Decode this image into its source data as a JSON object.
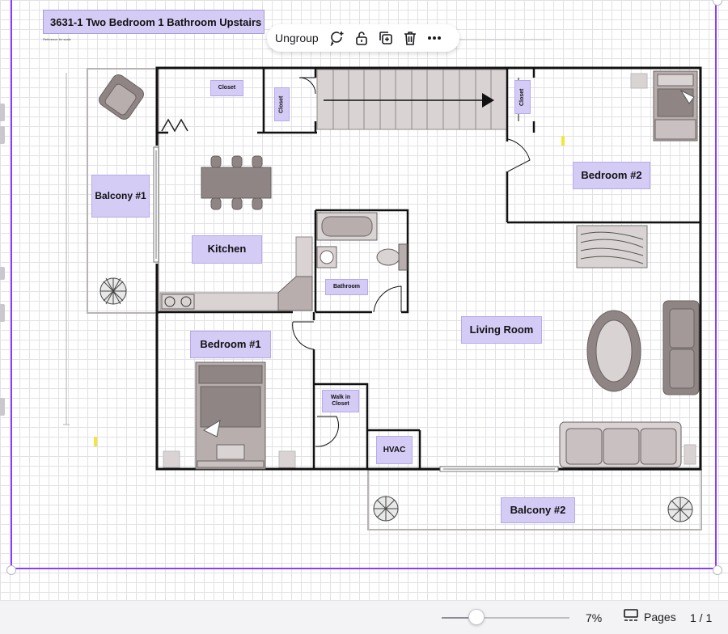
{
  "document": {
    "title": "3631-1 Two Bedroom 1 Bathroom Upstairs",
    "scale_note": "Reference for scale"
  },
  "toolbar": {
    "ungroup_label": "Ungroup",
    "icons": [
      "comment-add-icon",
      "lock-icon",
      "duplicate-icon",
      "trash-icon",
      "more-icon"
    ]
  },
  "rooms": {
    "balcony1": "Balcony #1",
    "closet_top": "Closet",
    "closet_stair": "Closet",
    "closet_right": "Closet",
    "kitchen": "Kitchen",
    "bathroom": "Bathroom",
    "bedroom2": "Bedroom #2",
    "living_room": "Living Room",
    "bedroom1": "Bedroom #1",
    "walk_in_closet": "Walk in Closet",
    "hvac": "HVAC",
    "balcony2": "Balcony #2"
  },
  "bottom_bar": {
    "zoom": "7%",
    "zoom_fraction": 0.27,
    "pages_label": "Pages",
    "page_count": "1 / 1"
  },
  "colors": {
    "accent": "#8b3dff",
    "label_fill": "#d5ccf6",
    "furniture": "#b8aeae"
  }
}
